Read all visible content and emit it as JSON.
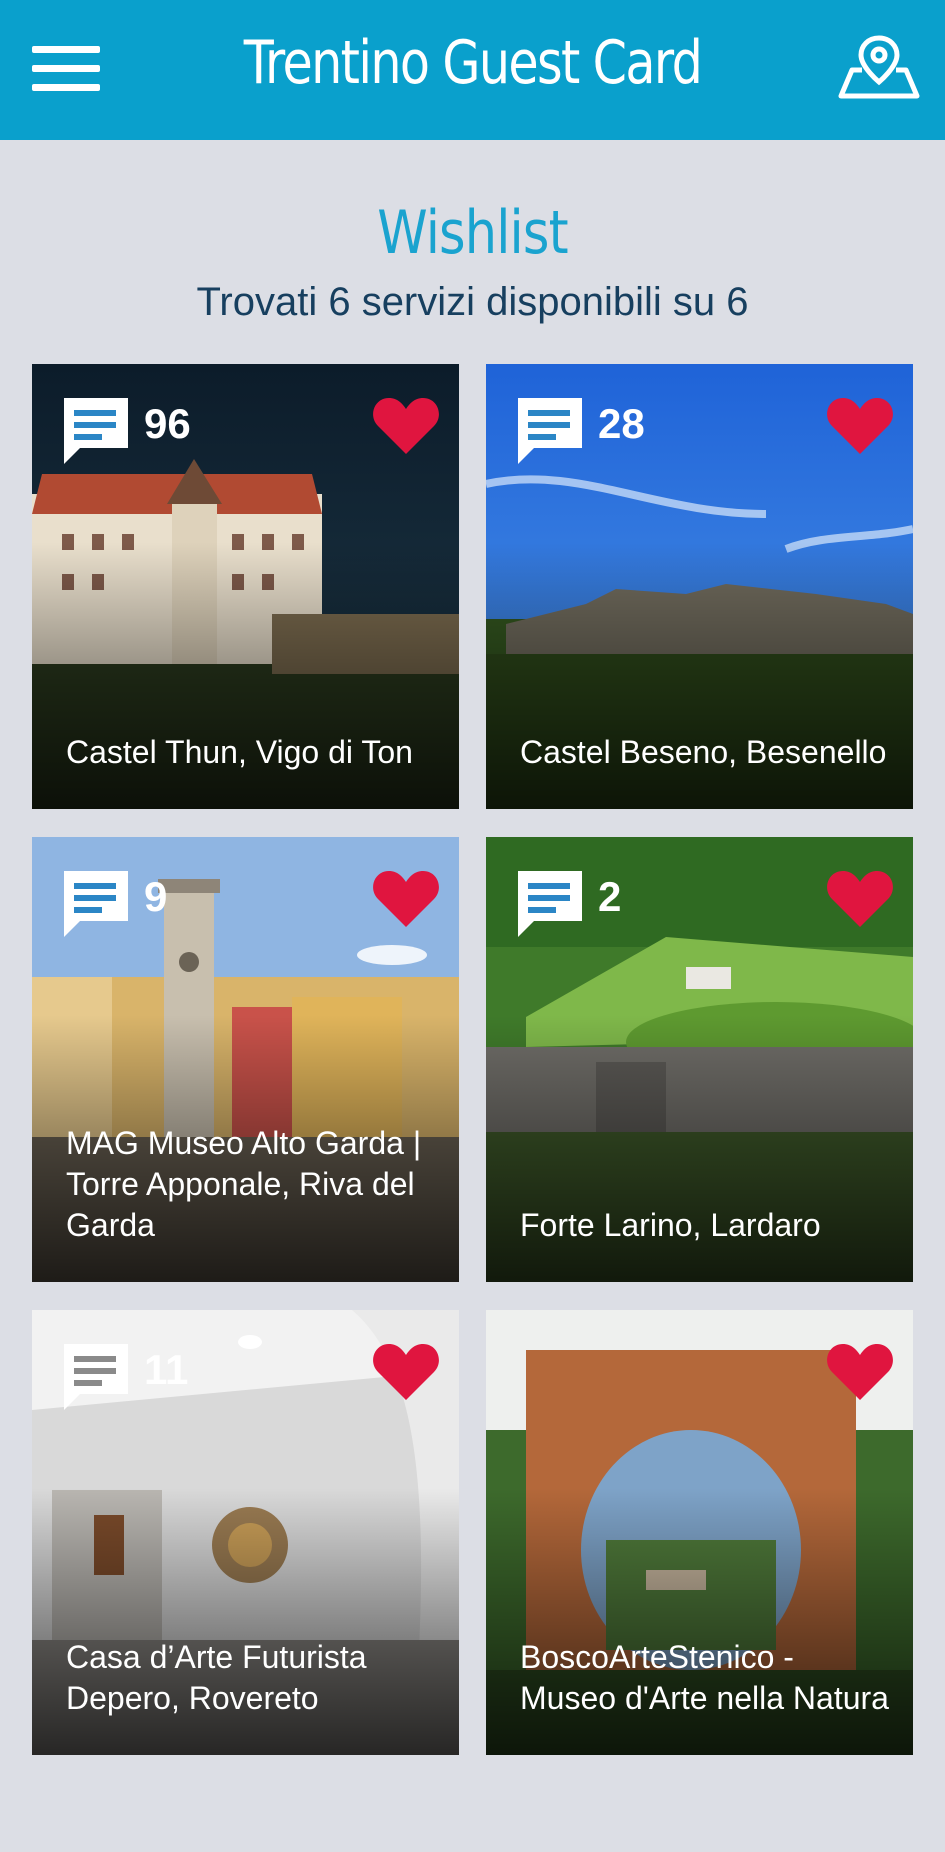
{
  "header": {
    "title": "Trentino Guest Card",
    "menu_icon": "hamburger-menu-icon",
    "map_icon": "map-pin-icon"
  },
  "page": {
    "title": "Wishlist",
    "subtitle": "Trovati 6 servizi disponibili su 6"
  },
  "colors": {
    "appbar": "#0aa0cc",
    "background": "#dcdee5",
    "title": "#1aa3cf",
    "subtitle": "#173f5f",
    "heart": "#e0153f",
    "comment_icon_lines": "#2b86c6"
  },
  "cards": [
    {
      "name": "Castel Thun, Vigo di Ton",
      "comments": "96",
      "favorite": true
    },
    {
      "name": "Castel Beseno, Besenello",
      "comments": "28",
      "favorite": true
    },
    {
      "name": "MAG Museo Alto Garda | Torre Apponale, Riva del Garda",
      "comments": "9",
      "favorite": true
    },
    {
      "name": "Forte Larino, Lardaro",
      "comments": "2",
      "favorite": true
    },
    {
      "name": "Casa d’Arte Futurista Depero, Rovereto",
      "comments": "11",
      "favorite": true
    },
    {
      "name": "BoscoArteStenico - Museo d'Arte nella Natura",
      "comments": "",
      "favorite": true
    }
  ]
}
